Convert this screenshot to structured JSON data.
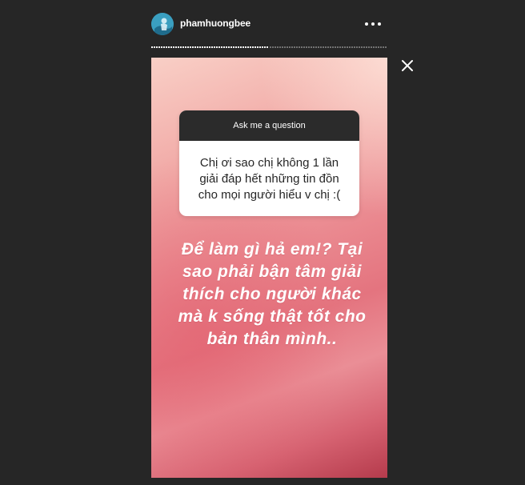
{
  "header": {
    "username": "phamhuongbee"
  },
  "progress": {
    "segments_total": 2,
    "segments_completed": 1
  },
  "story": {
    "question_box": {
      "header": "Ask me a question",
      "question": "Chị ơi sao chị không 1 lần giải đáp hết những tin đồn cho mọi người hiểu v chị :("
    },
    "answer": "Để làm gì hả em!? Tại sao phải bận tâm giải thích cho người khác mà k sống thật tốt cho bản thân mình.."
  },
  "icons": {
    "more": "more-horizontal-icon",
    "close": "close-icon"
  },
  "colors": {
    "background": "#262626",
    "question_header": "#2b2b2b",
    "gradient_top": "#f9cfc6",
    "gradient_bottom": "#b53b4c"
  }
}
